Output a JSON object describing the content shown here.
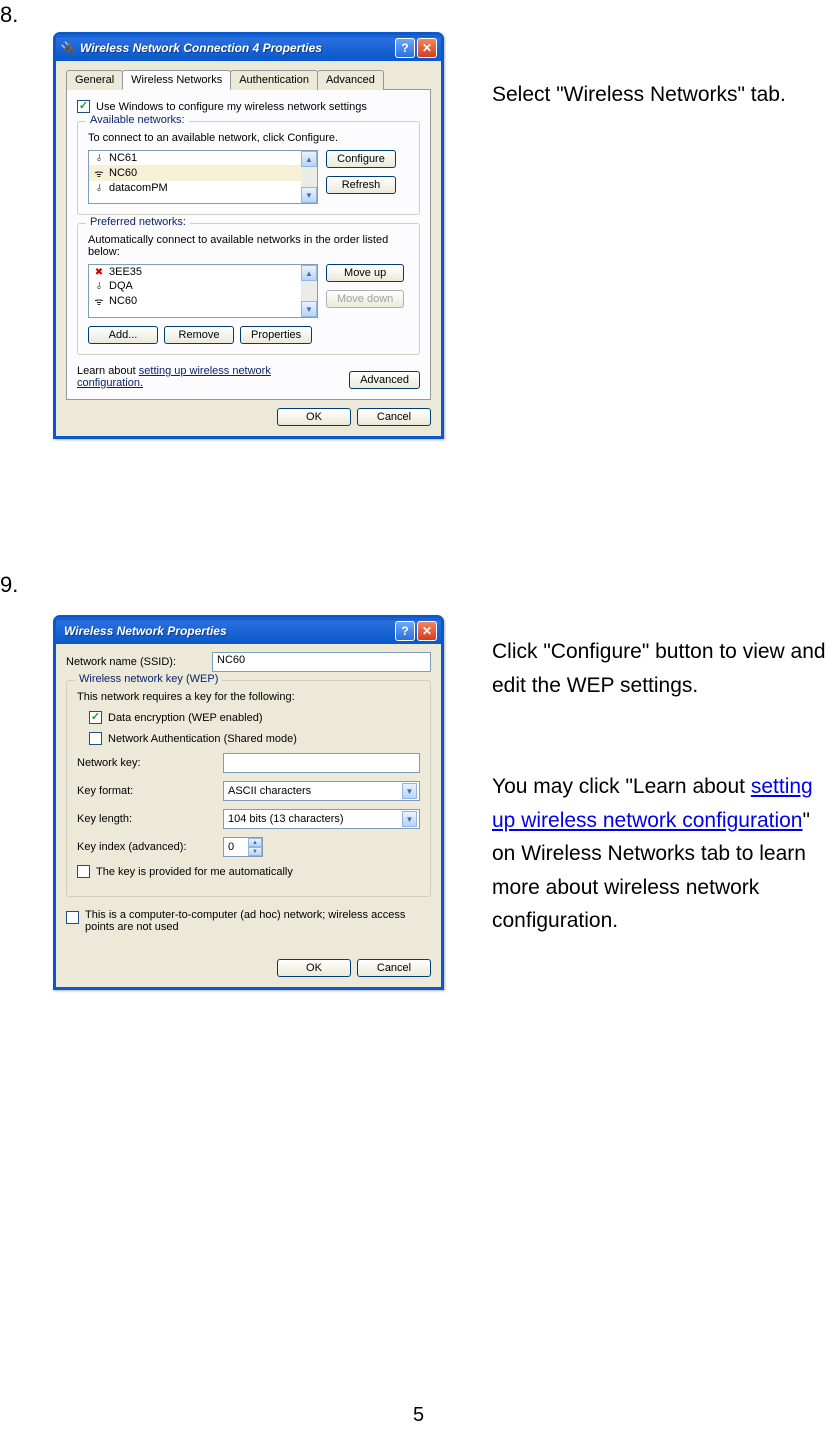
{
  "step8": {
    "number": "8.",
    "desc": "Select \"Wireless Networks\" tab."
  },
  "step9": {
    "number": "9.",
    "desc_part1": "Click \"Configure\" button to view and edit the WEP settings.",
    "desc_part2a": "You may click \"Learn about ",
    "desc_link": "setting up wireless network configuration",
    "desc_part2b": "\" on Wireless Networks tab to learn more about wireless network configuration."
  },
  "win1": {
    "title": "Wireless Network Connection 4 Properties",
    "tabs": {
      "general": "General",
      "wireless": "Wireless Networks",
      "auth": "Authentication",
      "advanced": "Advanced"
    },
    "use_windows": "Use Windows to configure my wireless network settings",
    "available": {
      "title": "Available networks:",
      "hint": "To connect to an available network, click Configure.",
      "items": [
        "NC61",
        "NC60",
        "datacomPM"
      ],
      "configure": "Configure",
      "refresh": "Refresh"
    },
    "preferred": {
      "title": "Preferred networks:",
      "hint": "Automatically connect to available networks in the order listed below:",
      "items": [
        "3EE35",
        "DQA",
        "NC60"
      ],
      "moveup": "Move up",
      "movedown": "Move down",
      "add": "Add...",
      "remove": "Remove",
      "properties": "Properties"
    },
    "learn_pre": "Learn about ",
    "learn_link": "setting up wireless network configuration.",
    "advanced_btn": "Advanced",
    "ok": "OK",
    "cancel": "Cancel"
  },
  "win2": {
    "title": "Wireless Network Properties",
    "ssid_label": "Network name (SSID):",
    "ssid_value": "NC60",
    "group_title": "Wireless network key (WEP)",
    "group_hint": "This network requires a key for the following:",
    "chk_data": "Data encryption (WEP enabled)",
    "chk_auth": "Network Authentication (Shared mode)",
    "key_label": "Network key:",
    "format_label": "Key format:",
    "format_value": "ASCII characters",
    "length_label": "Key length:",
    "length_value": "104 bits (13 characters)",
    "index_label": "Key index (advanced):",
    "index_value": "0",
    "chk_auto": "The key is provided for me automatically",
    "chk_adhoc": "This is a computer-to-computer (ad hoc) network; wireless access points are not used",
    "ok": "OK",
    "cancel": "Cancel"
  },
  "page_number": "5"
}
